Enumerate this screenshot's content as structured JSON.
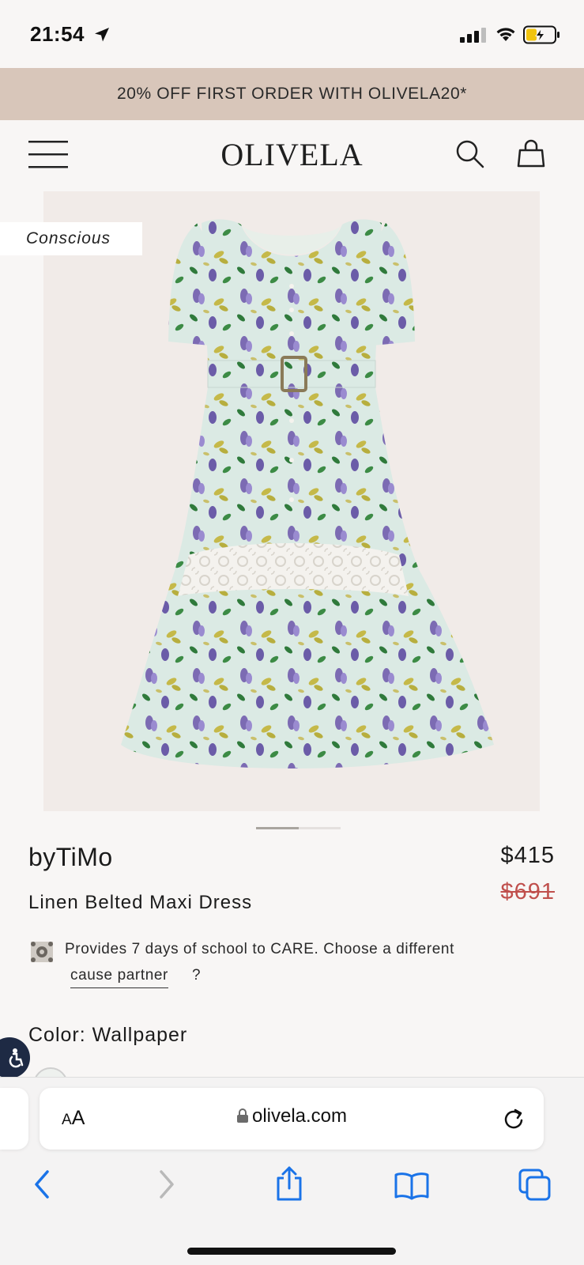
{
  "status_bar": {
    "time": "21:54"
  },
  "promo": {
    "text": "20% OFF FIRST ORDER WITH OLIVELA20*"
  },
  "header": {
    "logo": "OLIVELA"
  },
  "product": {
    "badge": "Conscious",
    "brand": "byTiMo",
    "price": "$415",
    "original_price": "$691",
    "name": "Linen Belted Maxi Dress",
    "cause_text": "Provides 7 days of school to CARE. Choose a different",
    "cause_link": "cause partner",
    "cause_question": "?",
    "color_label": "Color: Wallpaper",
    "image_count": 2,
    "image_index": 1
  },
  "browser": {
    "aa_label_big": "A",
    "aa_label_small": "A",
    "url": "olivela.com"
  },
  "colors": {
    "promo_bg": "#d8c6ba",
    "old_price": "#c0504d",
    "safari_blue": "#1a73e8",
    "a11y_bg": "#1e2a44"
  },
  "icons": [
    "location-arrow-icon",
    "signal-icon",
    "wifi-icon",
    "battery-charging-icon",
    "menu-icon",
    "search-icon",
    "bag-icon",
    "cause-icon",
    "accessibility-icon",
    "lock-icon",
    "reload-icon",
    "back-icon",
    "forward-icon",
    "share-icon",
    "bookmarks-icon",
    "tabs-icon"
  ]
}
